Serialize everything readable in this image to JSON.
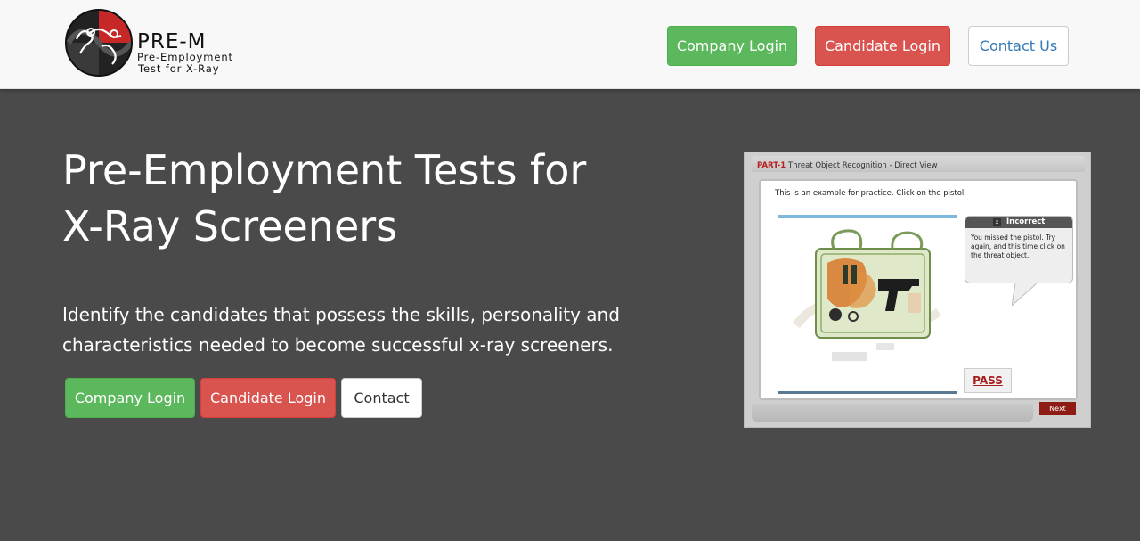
{
  "header": {
    "brand_name": "PRE-M",
    "brand_sub_line1": "Pre-Employment",
    "brand_sub_line2": "Test for X-Ray",
    "company_login": "Company Login",
    "candidate_login": "Candidate Login",
    "contact_us": "Contact Us"
  },
  "hero": {
    "title_line1": "Pre-Employment Tests for",
    "title_line2": "X-Ray Screeners",
    "description": "Identify the candidates that possess the skills, personality and characteristics needed to become successful x-ray screeners.",
    "company_login": "Company Login",
    "candidate_login": "Candidate Login",
    "contact": "Contact"
  },
  "preview": {
    "part": "PART-1",
    "title": "Threat Object Recognition - Direct View",
    "instruction": "This is an example for practice. Click on the pistol.",
    "feedback_close": "x",
    "feedback_title": "Incorrect",
    "feedback_text": "You missed the pistol. Try again, and this time click on the threat object.",
    "pass_label": "PASS",
    "next_label": "Next"
  },
  "colors": {
    "background": "#4a4a4a",
    "header_bg": "#f8f8f8",
    "success": "#5cb85c",
    "danger": "#d9534f",
    "link": "#337ab7",
    "accent_dark_red": "#8e1b14"
  }
}
